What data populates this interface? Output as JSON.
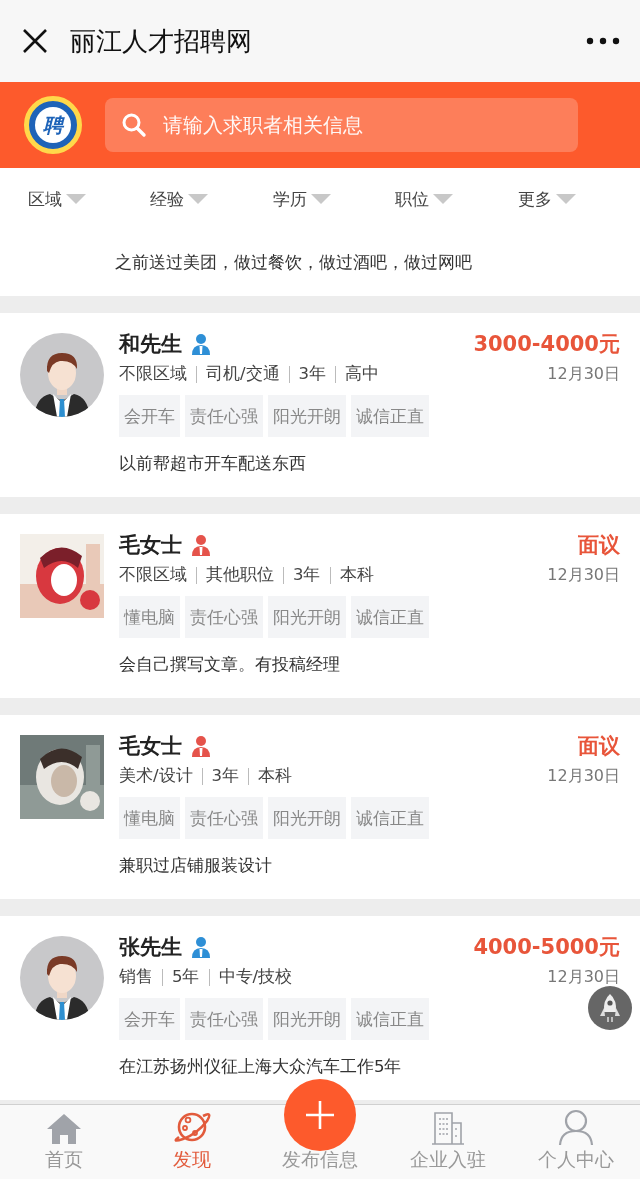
{
  "window": {
    "title": "丽江人才招聘网"
  },
  "header": {
    "logo": "聘",
    "search": {
      "placeholder": "请输入求职者相关信息"
    }
  },
  "filters": [
    {
      "label": "区域"
    },
    {
      "label": "经验"
    },
    {
      "label": "学历"
    },
    {
      "label": "职位"
    },
    {
      "label": "更多"
    }
  ],
  "partial_card": {
    "description": "之前送过美团，做过餐饮，做过酒吧，做过网吧"
  },
  "cards": [
    {
      "name": "和先生",
      "badge": {
        "kind": "male"
      },
      "avatar": {
        "kind": "default"
      },
      "salary": "3000-4000元",
      "meta": [
        "不限区域",
        "司机/交通",
        "3年",
        "高中"
      ],
      "date": "12月30日",
      "tags": [
        "会开车",
        "责任心强",
        "阳光开朗",
        "诚信正直"
      ],
      "description": "以前帮超市开车配送东西"
    },
    {
      "name": "毛女士",
      "badge": {
        "kind": "female"
      },
      "avatar": {
        "kind": "picture"
      },
      "salary": "面议",
      "meta": [
        "不限区域",
        "其他职位",
        "3年",
        "本科"
      ],
      "date": "12月30日",
      "tags": [
        "懂电脑",
        "责任心强",
        "阳光开朗",
        "诚信正直"
      ],
      "description": "会自己撰写文章。有投稿经理"
    },
    {
      "name": "毛女士",
      "badge": {
        "kind": "female"
      },
      "avatar": {
        "kind": "picture"
      },
      "salary": "面议",
      "meta": [
        "美术/设计",
        "3年",
        "本科"
      ],
      "date": "12月30日",
      "tags": [
        "懂电脑",
        "责任心强",
        "阳光开朗",
        "诚信正直"
      ],
      "description": "兼职过店铺服装设计"
    },
    {
      "name": "张先生",
      "badge": {
        "kind": "male"
      },
      "avatar": {
        "kind": "default"
      },
      "salary": "4000-5000元",
      "meta": [
        "销售",
        "5年",
        "中专/技校"
      ],
      "date": "12月30日",
      "tags": [
        "会开车",
        "责任心强",
        "阳光开朗",
        "诚信正直"
      ],
      "description": "在江苏扬州仪征上海大众汽车工作5年"
    }
  ],
  "tabs": [
    {
      "kind": "home",
      "label": "首页",
      "selected": false
    },
    {
      "kind": "discover",
      "label": "发现",
      "selected": true
    },
    {
      "kind": "post",
      "label": "发布信息",
      "selected": false
    },
    {
      "kind": "company",
      "label": "企业入驻",
      "selected": false
    },
    {
      "kind": "profile",
      "label": "个人中心",
      "selected": false
    }
  ]
}
